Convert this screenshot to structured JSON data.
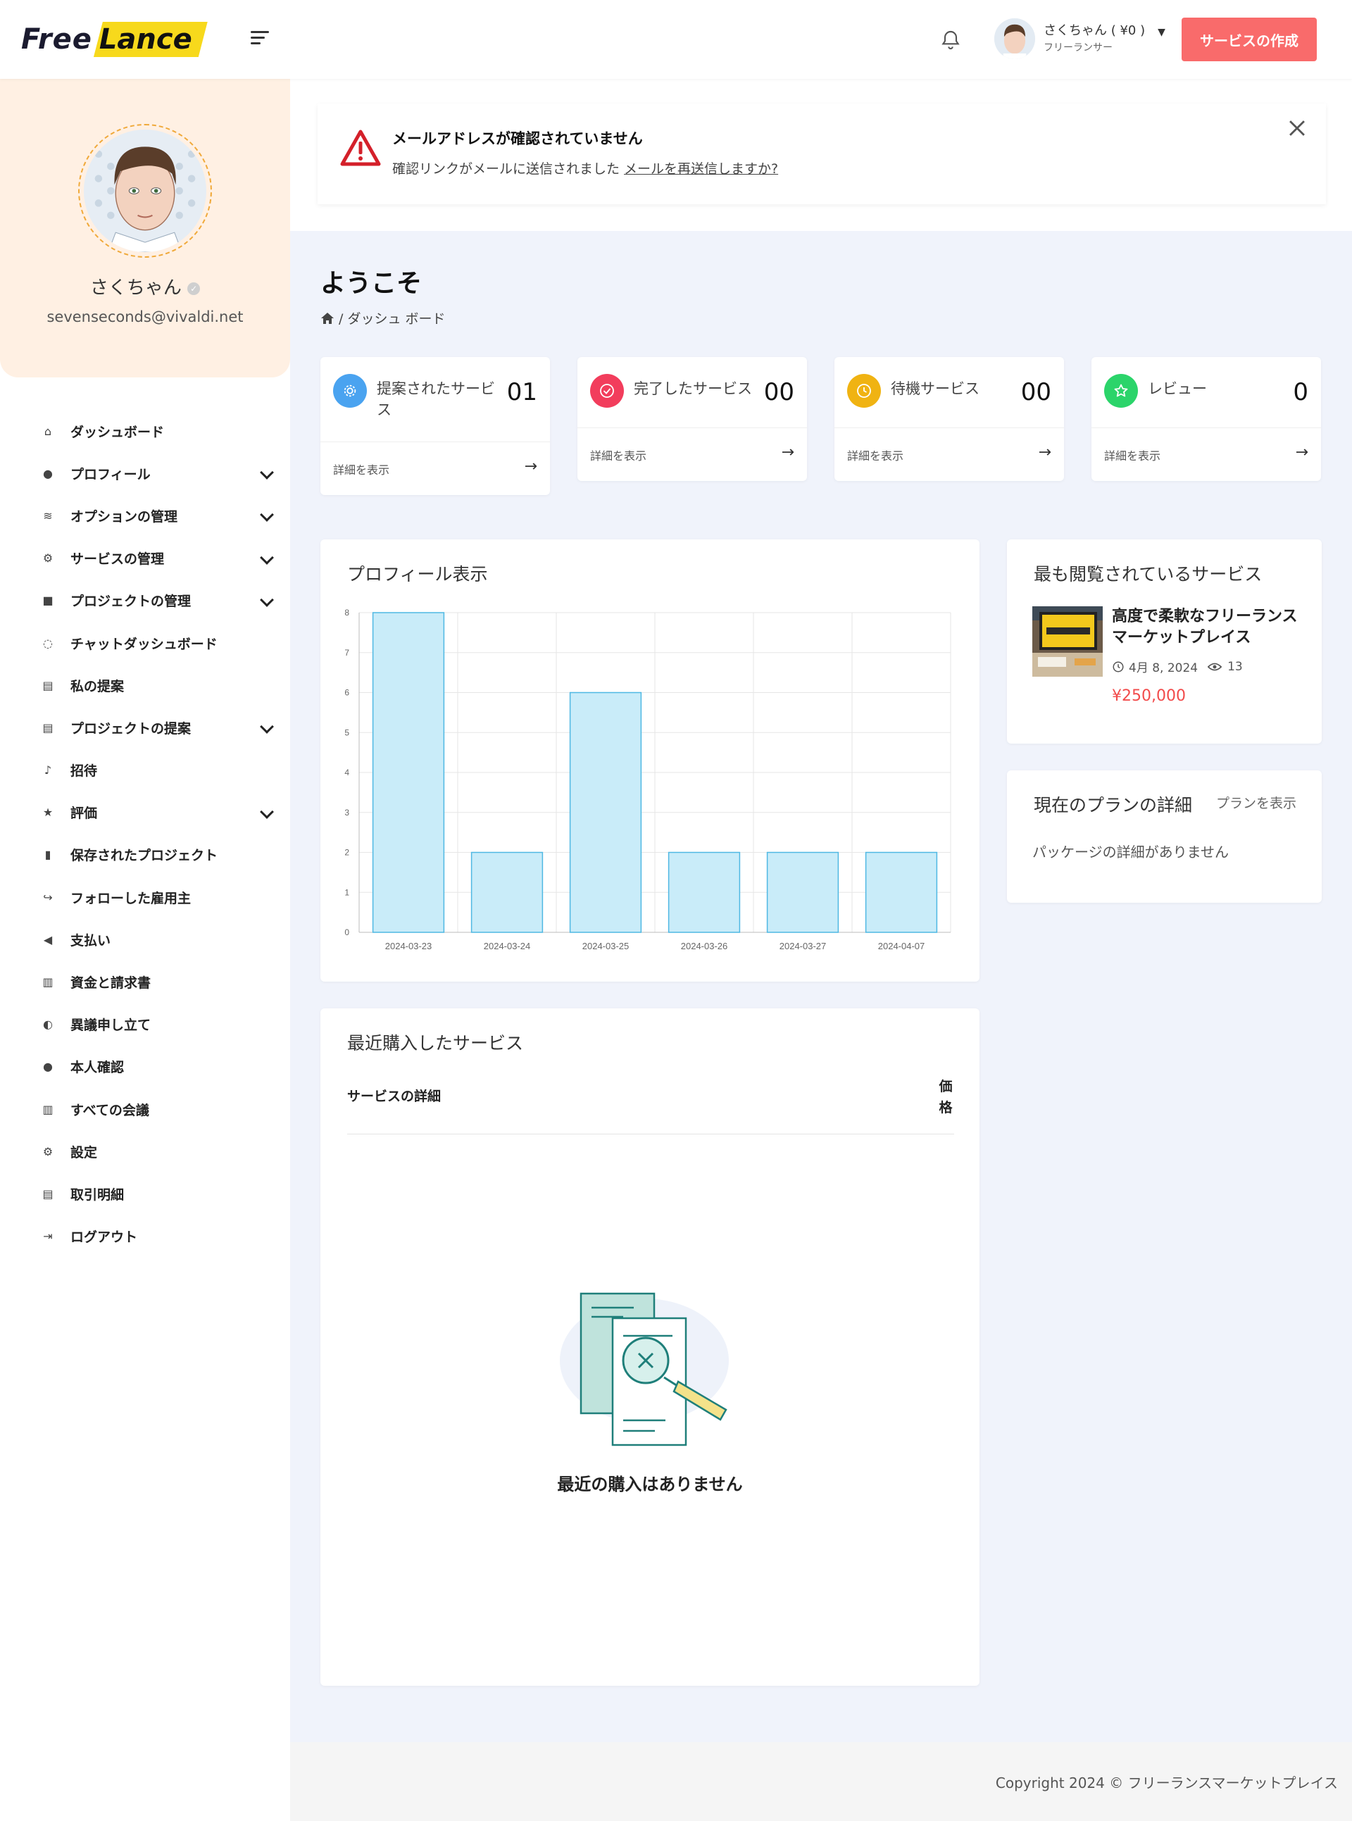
{
  "header": {
    "logo_part1": "Free",
    "logo_part2": "Lance",
    "user_name": "さくちゃん ( ¥0 )",
    "user_role": "フリーランサー",
    "create_button": "サービスの作成"
  },
  "sidebar": {
    "profile_name": "さくちゃん",
    "profile_email": "sevenseconds@vivaldi.net",
    "items": [
      {
        "label": "ダッシュボード",
        "icon": "home-icon",
        "has_sub": false
      },
      {
        "label": "プロフィール",
        "icon": "user-icon",
        "has_sub": true
      },
      {
        "label": "オプションの管理",
        "icon": "layers-icon",
        "has_sub": true
      },
      {
        "label": "サービスの管理",
        "icon": "user-gear-icon",
        "has_sub": true
      },
      {
        "label": "プロジェクトの管理",
        "icon": "briefcase-icon",
        "has_sub": true
      },
      {
        "label": "チャットダッシュボード",
        "icon": "chat-icon",
        "has_sub": false
      },
      {
        "label": "私の提案",
        "icon": "document-icon",
        "has_sub": false
      },
      {
        "label": "プロジェクトの提案",
        "icon": "document-icon",
        "has_sub": true
      },
      {
        "label": "招待",
        "icon": "bell-icon",
        "has_sub": false
      },
      {
        "label": "評価",
        "icon": "star-icon",
        "has_sub": true
      },
      {
        "label": "保存されたプロジェクト",
        "icon": "bookmark-icon",
        "has_sub": false
      },
      {
        "label": "フォローした雇用主",
        "icon": "share-icon",
        "has_sub": false
      },
      {
        "label": "支払い",
        "icon": "megaphone-icon",
        "has_sub": false
      },
      {
        "label": "資金と請求書",
        "icon": "receipt-icon",
        "has_sub": false
      },
      {
        "label": "異議申し立て",
        "icon": "shield-icon",
        "has_sub": false
      },
      {
        "label": "本人確認",
        "icon": "user-check-icon",
        "has_sub": false
      },
      {
        "label": "すべての会議",
        "icon": "calendar-icon",
        "has_sub": false
      },
      {
        "label": "設定",
        "icon": "gear-icon",
        "has_sub": false
      },
      {
        "label": "取引明細",
        "icon": "list-icon",
        "has_sub": false
      },
      {
        "label": "ログアウト",
        "icon": "logout-icon",
        "has_sub": false
      }
    ]
  },
  "alert": {
    "title": "メールアドレスが確認されていません",
    "message": "確認リンクがメールに送信されました",
    "link": "メールを再送信しますか?"
  },
  "welcome": {
    "title": "ようこそ",
    "breadcrumb": "/ ダッシュ ボード"
  },
  "stats": [
    {
      "title": "提案されたサービス",
      "value": "01",
      "footer": "詳細を表示",
      "color": "#4aa3f0",
      "icon": "gear-icon"
    },
    {
      "title": "完了したサービス",
      "value": "00",
      "footer": "詳細を表示",
      "color": "#f23d5c",
      "icon": "check-circle-icon"
    },
    {
      "title": "待機サービス",
      "value": "00",
      "footer": "詳細を表示",
      "color": "#f0b312",
      "icon": "clock-icon"
    },
    {
      "title": "レビュー",
      "value": "0",
      "footer": "詳細を表示",
      "color": "#2bd46a",
      "icon": "star-icon"
    }
  ],
  "profile_views": {
    "title": "プロフィール表示"
  },
  "chart_data": {
    "type": "bar",
    "categories": [
      "2024-03-23",
      "2024-03-24",
      "2024-03-25",
      "2024-03-26",
      "2024-03-27",
      "2024-04-07"
    ],
    "values": [
      8,
      2,
      6,
      2,
      2,
      2
    ],
    "ylim": [
      0,
      8
    ],
    "yticks": [
      0,
      1,
      2,
      3,
      4,
      5,
      6,
      7,
      8
    ],
    "grid": true,
    "bar_fill": "#c9ecf9",
    "bar_stroke": "#4fb8e3"
  },
  "top_service": {
    "title": "最も閲覧されているサービス",
    "service_title": "高度で柔軟なフリーランスマーケットプレイス",
    "date": "4月 8, 2024",
    "views": "13",
    "price": "¥250,000"
  },
  "plan": {
    "title": "現在のプランの詳細",
    "view_link": "プランを表示",
    "empty": "パッケージの詳細がありません"
  },
  "purchases": {
    "title": "最近購入したサービス",
    "col_detail": "サービスの詳細",
    "col_price": "価格",
    "empty": "最近の購入はありません"
  },
  "footer": {
    "copyright": "Copyright 2024 © フリーランスマーケットプレイス"
  }
}
